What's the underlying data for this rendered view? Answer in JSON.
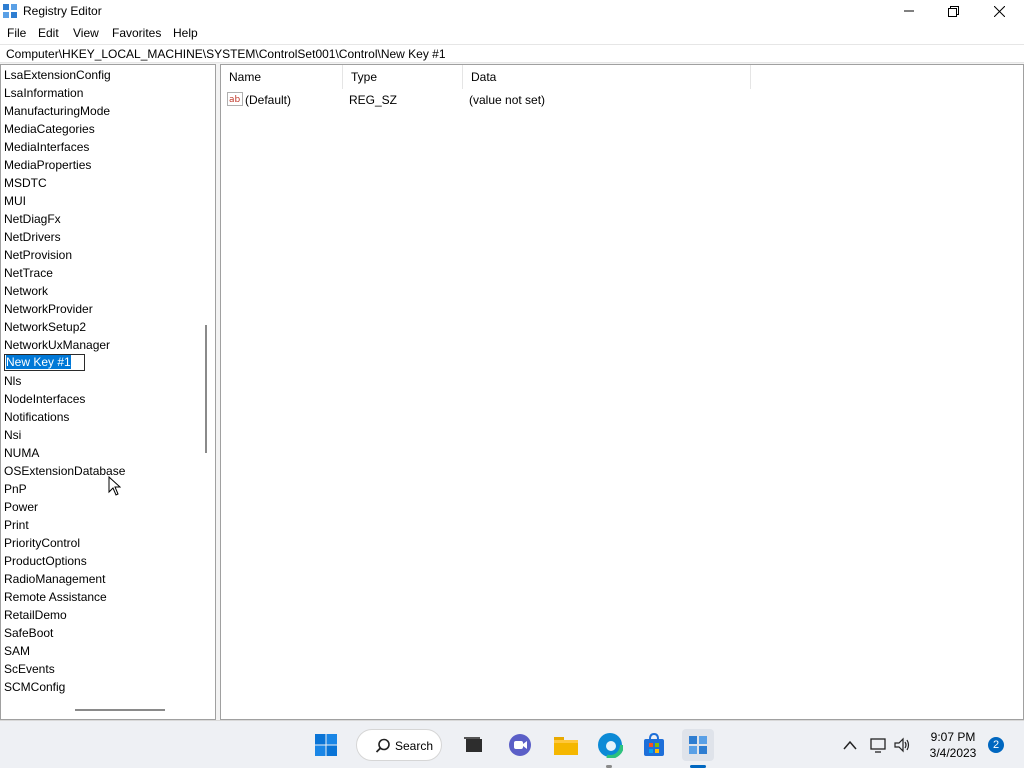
{
  "window": {
    "title": "Registry Editor"
  },
  "menu": [
    "File",
    "Edit",
    "View",
    "Favorites",
    "Help"
  ],
  "address": "Computer\\HKEY_LOCAL_MACHINE\\SYSTEM\\ControlSet001\\Control\\New Key #1",
  "tree": {
    "items": [
      "LsaExtensionConfig",
      "LsaInformation",
      "ManufacturingMode",
      "MediaCategories",
      "MediaInterfaces",
      "MediaProperties",
      "MSDTC",
      "MUI",
      "NetDiagFx",
      "NetDrivers",
      "NetProvision",
      "NetTrace",
      "Network",
      "NetworkProvider",
      "NetworkSetup2",
      "NetworkUxManager",
      "New Key #1",
      "Nls",
      "NodeInterfaces",
      "Notifications",
      "Nsi",
      "NUMA",
      "OSExtensionDatabase",
      "PnP",
      "Power",
      "Print",
      "PriorityControl",
      "ProductOptions",
      "RadioManagement",
      "Remote Assistance",
      "RetailDemo",
      "SafeBoot",
      "SAM",
      "ScEvents",
      "SCMConfig"
    ],
    "editing_item": "New Key #1"
  },
  "values": {
    "columns": [
      "Name",
      "Type",
      "Data"
    ],
    "rows": [
      {
        "name": "(Default)",
        "type": "REG_SZ",
        "data": "(value not set)"
      }
    ]
  },
  "taskbar": {
    "search_label": "Search",
    "time": "9:07 PM",
    "date": "3/4/2023",
    "notification_count": "2"
  }
}
